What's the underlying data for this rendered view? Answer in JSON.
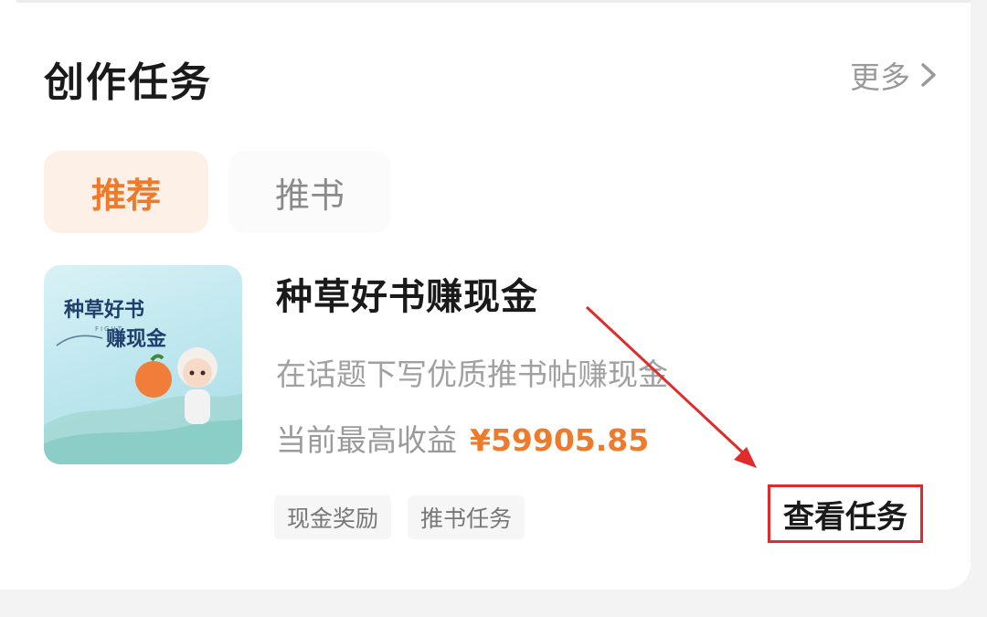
{
  "header": {
    "title": "创作任务",
    "more_label": "更多",
    "more_icon": "chevron-right-icon"
  },
  "tabs": [
    {
      "label": "推荐",
      "active": true
    },
    {
      "label": "推书",
      "active": false
    }
  ],
  "task": {
    "thumbnail_text_line1": "种草好书",
    "thumbnail_text_small": "FIGHT",
    "thumbnail_text_line2": "赚现金",
    "title": "种草好书赚现金",
    "description": "在话题下写优质推书帖赚现金",
    "earnings_label": "当前最高收益",
    "earnings_amount": "¥59905.85",
    "tags": [
      "现金奖励",
      "推书任务"
    ],
    "action_label": "查看任务"
  },
  "colors": {
    "accent": "#f07a2a",
    "annotation": "#e02b2b",
    "tab_active_bg": "#fdf0e6"
  }
}
